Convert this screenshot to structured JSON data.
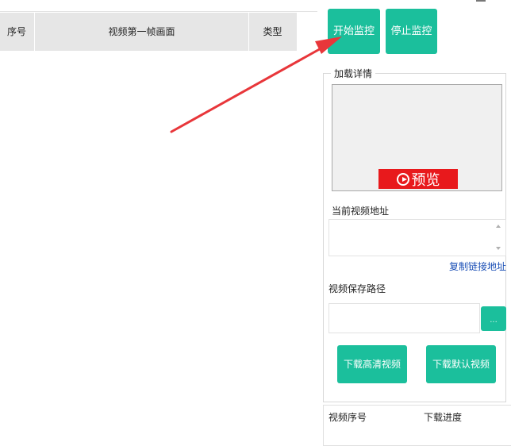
{
  "table": {
    "headers": {
      "index": "序号",
      "first_frame": "视频第一帧画面",
      "type": "类型"
    }
  },
  "controls": {
    "start_label": "开始监控",
    "stop_label": "停止监控"
  },
  "details": {
    "group_title": "加载详情",
    "preview_label": "预览",
    "current_url_label": "当前视频地址",
    "copy_link_label": "复制链接地址",
    "save_path_label": "视频保存路径",
    "browse_label": "...",
    "download_hd_label": "下载高清视频",
    "download_default_label": "下载默认视频"
  },
  "downloads": {
    "col_index": "视频序号",
    "col_progress": "下载进度"
  },
  "colors": {
    "accent": "#1bbf9c",
    "preview_red": "#e8191c",
    "arrow_red": "#e8363a",
    "link_blue": "#1b4fb6"
  },
  "icons": {
    "preview": "play-circle-icon",
    "annotation": "arrow-annotation"
  }
}
